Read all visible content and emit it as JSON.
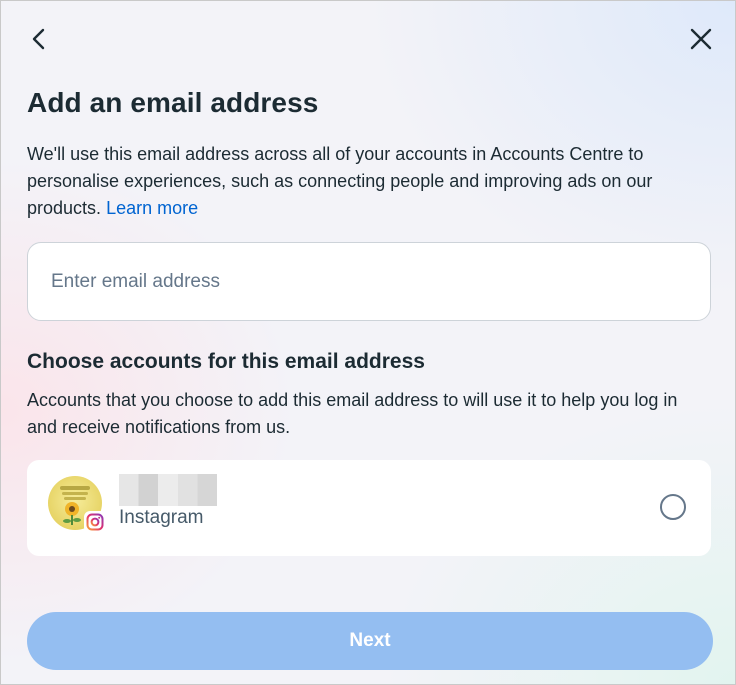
{
  "dialog": {
    "title": "Add an email address",
    "description": "We'll use this email address across all of your accounts in Accounts Centre to personalise experiences, such as connecting people and improving ads on our products.",
    "learn_more": "Learn more"
  },
  "email": {
    "placeholder": "Enter email address",
    "value": ""
  },
  "accounts_section": {
    "title": "Choose accounts for this email address",
    "description": "Accounts that you choose to add this email address to will use it to help you log in and receive notifications from us."
  },
  "accounts": [
    {
      "platform": "Instagram",
      "selected": false
    }
  ],
  "buttons": {
    "next_label": "Next"
  },
  "icons": {
    "back": "chevron-left-icon",
    "close": "close-icon",
    "instagram": "instagram-icon"
  },
  "colors": {
    "link": "#0064d1",
    "next_button_disabled": "#94bef1",
    "text": "#1c2b33"
  }
}
